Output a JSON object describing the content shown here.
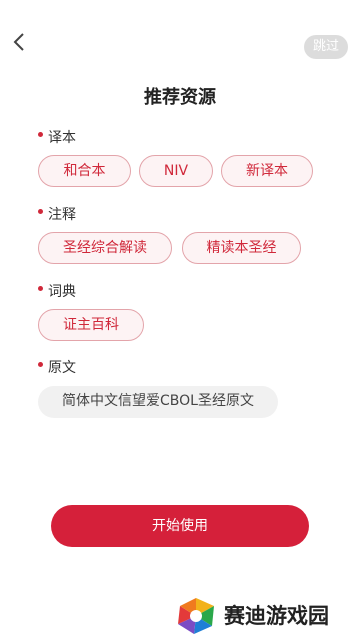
{
  "header": {
    "back_icon": "chevron-left-icon",
    "skip_label": "跳过",
    "title": "推荐资源"
  },
  "sections": [
    {
      "label": "译本",
      "items": [
        "和合本",
        "NIV",
        "新译本"
      ]
    },
    {
      "label": "注释",
      "items": [
        "圣经综合解读",
        "精读本圣经"
      ]
    },
    {
      "label": "词典",
      "items": [
        "证主百科"
      ]
    },
    {
      "label": "原文",
      "items": [
        "简体中文信望爱CBOL圣经原文"
      ]
    }
  ],
  "footer": {
    "start_label": "开始使用"
  },
  "watermark": {
    "text": "赛迪游戏园"
  },
  "colors": {
    "accent": "#d5203a",
    "chip_border": "#e3a4aa",
    "chip_bg": "#fdf3f4",
    "skip_bg": "#dcdcdc"
  }
}
